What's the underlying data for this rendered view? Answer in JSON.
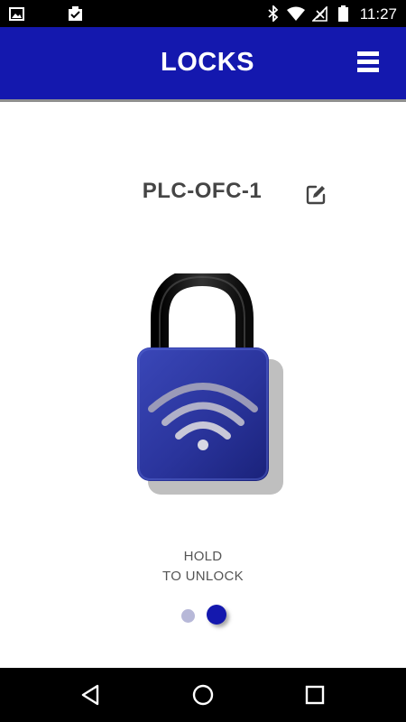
{
  "status_bar": {
    "time": "11:27",
    "left_icons": [
      "image-icon",
      "clipboard-check-icon"
    ],
    "right_icons": [
      "bluetooth-icon",
      "wifi-icon",
      "no-signal-icon",
      "battery-icon"
    ]
  },
  "app_bar": {
    "title": "LOCKS",
    "menu_icon": "hamburger-menu-icon",
    "background": "#1418ae"
  },
  "lock": {
    "name": "PLC-OFC-1",
    "edit_icon": "edit-icon",
    "icon": "padlock-wifi-icon",
    "body_color": "#2b35a0",
    "shackle_color": "#1a1a1a"
  },
  "hold": {
    "line1": "HOLD",
    "line2": "TO UNLOCK"
  },
  "pager": {
    "count": 2,
    "active_index": 1,
    "active_color": "#1418ae",
    "inactive_color": "#b7b8d8"
  },
  "nav_bar": {
    "buttons": [
      "back-icon",
      "home-icon",
      "recents-icon"
    ]
  }
}
